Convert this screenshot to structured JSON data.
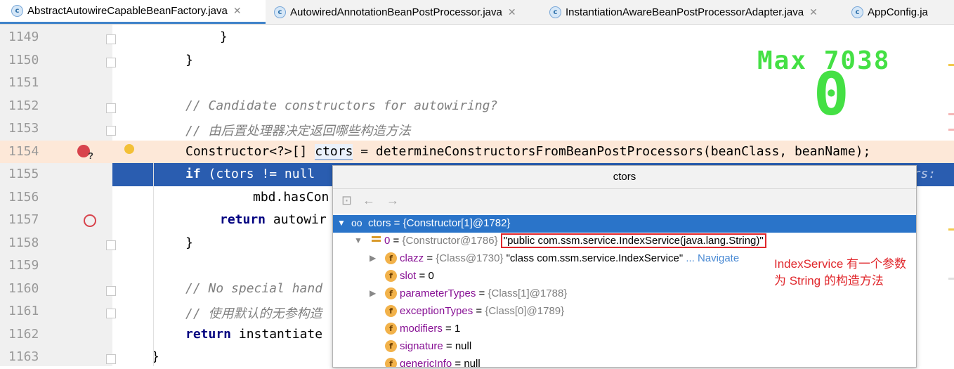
{
  "tabs": [
    {
      "label": "AbstractAutowireCapableBeanFactory.java",
      "icon": "c",
      "active": true
    },
    {
      "label": "AutowiredAnnotationBeanPostProcessor.java",
      "icon": "c"
    },
    {
      "label": "InstantiationAwareBeanPostProcessorAdapter.java",
      "icon": "c"
    },
    {
      "label": "AppConfig.ja",
      "icon": "c"
    }
  ],
  "lines": [
    {
      "num": "1149",
      "code": "}"
    },
    {
      "num": "1150",
      "code": "}"
    },
    {
      "num": "1151",
      "code": ""
    },
    {
      "num": "1152",
      "code": "// Candidate constructors for autowiring?"
    },
    {
      "num": "1153",
      "code": "// 由后置处理器决定返回哪些构造方法"
    },
    {
      "num": "1154",
      "kw": "Constructor<?>[] ",
      "var": "ctors",
      "rest": " = determineConstructorsFromBeanPostProcessors(beanClass, beanName);"
    },
    {
      "num": "1155",
      "kw": "if",
      "rest": " (ctors != null",
      "tail": "tors:"
    },
    {
      "num": "1156",
      "code": "mbd.hasCon"
    },
    {
      "num": "1157",
      "kw": "return",
      "rest": " autowir"
    },
    {
      "num": "1158",
      "code": "}"
    },
    {
      "num": "1159",
      "code": ""
    },
    {
      "num": "1160",
      "code": "// No special hand"
    },
    {
      "num": "1161",
      "code": "// 使用默认的无参构造"
    },
    {
      "num": "1162",
      "kw": "return",
      "rest": " instantiate"
    },
    {
      "num": "1163",
      "code": "}"
    }
  ],
  "score": {
    "max_label": "Max",
    "max_value": "7038",
    "current": "0"
  },
  "popup": {
    "title": "ctors",
    "rows": [
      {
        "name": "ctors",
        "eq": " = ",
        "value": "{Constructor[1]@1782}"
      },
      {
        "name": "0",
        "eq": " = ",
        "value": "{Constructor@1786} ",
        "str": "\"public com.ssm.service.IndexService(java.lang.String)\""
      },
      {
        "name": "clazz",
        "eq": " = ",
        "value": "{Class@1730} ",
        "str": "\"class com.ssm.service.IndexService\"",
        "nav": " ... Navigate"
      },
      {
        "name": "slot",
        "eq": " = ",
        "value": "0"
      },
      {
        "name": "parameterTypes",
        "eq": " = ",
        "value": "{Class[1]@1788}"
      },
      {
        "name": "exceptionTypes",
        "eq": " = ",
        "value": "{Class[0]@1789}"
      },
      {
        "name": "modifiers",
        "eq": " = ",
        "value": "1"
      },
      {
        "name": "signature",
        "eq": " = ",
        "value": "null"
      },
      {
        "name": "genericInfo",
        "eq": " = ",
        "value": "null"
      }
    ]
  },
  "annotation": {
    "line1": "IndexService 有一个参数",
    "line2": "为 String 的构造方法"
  },
  "colors": {
    "accent": "#2a5db0",
    "score": "#44e044",
    "annotation": "#e0262b"
  }
}
